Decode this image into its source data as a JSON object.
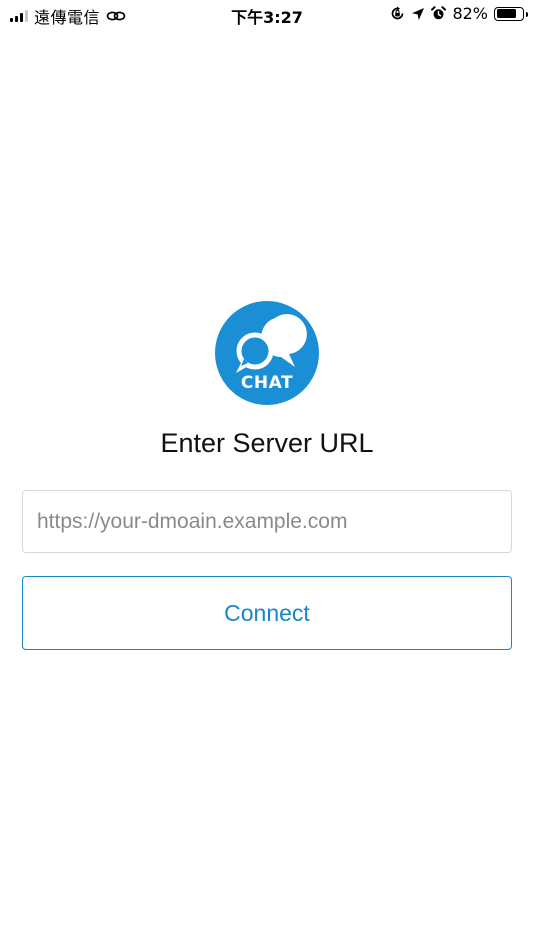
{
  "status_bar": {
    "carrier": "遠傳電信",
    "time": "下午3:27",
    "battery_percent": "82%",
    "battery_level": 0.82,
    "icons": [
      "signal-icon",
      "link-icon",
      "rotation-lock-icon",
      "location-arrow-icon",
      "alarm-icon",
      "battery-icon"
    ]
  },
  "logo": {
    "text": "CHAT",
    "color": "#1a8fd6"
  },
  "title": "Enter Server URL",
  "url_input": {
    "value": "",
    "placeholder": "https://your-dmoain.example.com"
  },
  "connect_button": {
    "label": "Connect",
    "color": "#1a86c8"
  }
}
